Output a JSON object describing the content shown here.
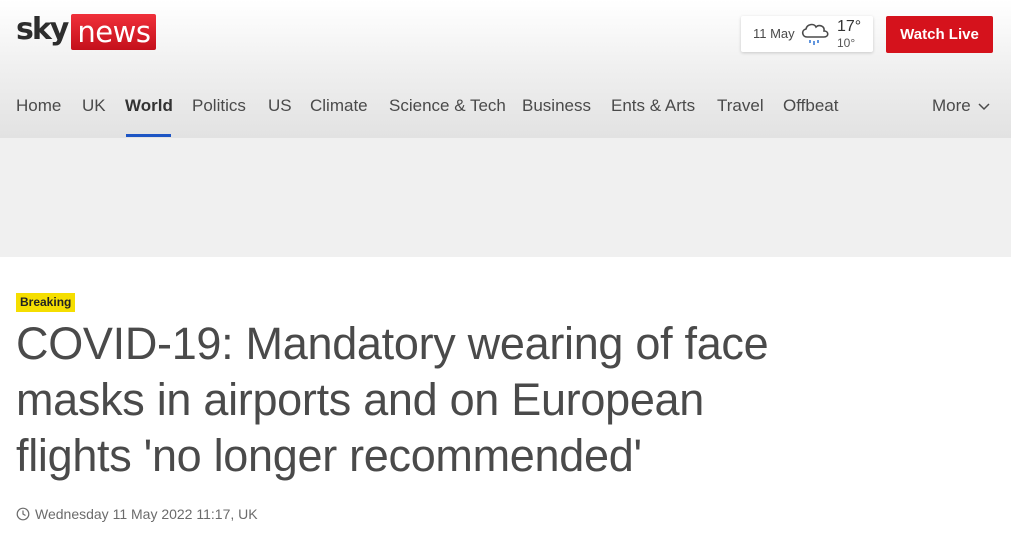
{
  "brand": {
    "logo_sky": "sky",
    "logo_news": "news",
    "accent": "#d5121c"
  },
  "weather": {
    "date": "11 May",
    "high": "17°",
    "low": "10°",
    "icon": "rain-cloud-icon"
  },
  "header": {
    "watch_live": "Watch Live"
  },
  "nav": {
    "items": [
      {
        "label": "Home"
      },
      {
        "label": "UK"
      },
      {
        "label": "World",
        "active": true
      },
      {
        "label": "Politics"
      },
      {
        "label": "US"
      },
      {
        "label": "Climate"
      },
      {
        "label": "Science & Tech"
      },
      {
        "label": "Business"
      },
      {
        "label": "Ents & Arts"
      },
      {
        "label": "Travel"
      },
      {
        "label": "Offbeat"
      }
    ],
    "more": "More",
    "active_color": "#1d55c4"
  },
  "article": {
    "badge": "Breaking",
    "badge_color": "#f5de00",
    "headline": "COVID-19: Mandatory wearing of face masks in airports and on European flights 'no longer recommended'",
    "timestamp": "Wednesday 11 May 2022 11:17, UK"
  }
}
